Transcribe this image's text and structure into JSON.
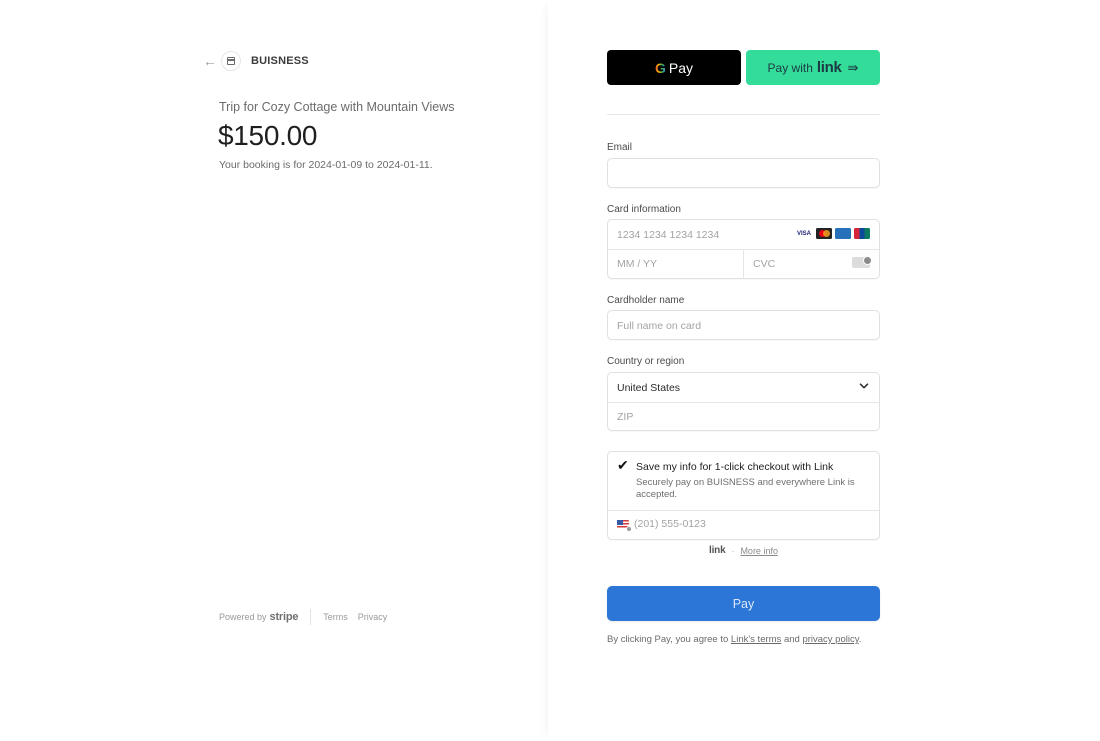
{
  "merchant": {
    "name": "BUISNESS",
    "back_icon": "back-arrow-icon",
    "logo_icon": "store-icon"
  },
  "summary": {
    "product": "Trip for Cozy Cottage with Mountain Views",
    "price": "$150.00",
    "booking_note": "Your booking is for 2024-01-09 to 2024-01-11."
  },
  "footer": {
    "powered_by": "Powered by",
    "stripe": "stripe",
    "terms": "Terms",
    "privacy": "Privacy"
  },
  "express": {
    "gpay_g": "G",
    "gpay_label": "Pay",
    "link_prefix": "Pay with",
    "link_logo": "link",
    "link_arrow": "⇛"
  },
  "form": {
    "email_label": "Email",
    "email_value": "",
    "card_label": "Card information",
    "card_number_placeholder": "1234 1234 1234 1234",
    "card_expiry_placeholder": "MM / YY",
    "card_cvc_placeholder": "CVC",
    "card_brands": [
      "VISA",
      "Mastercard",
      "Amex",
      "UnionPay"
    ],
    "cardholder_label": "Cardholder name",
    "cardholder_placeholder": "Full name on card",
    "country_label": "Country or region",
    "country_value": "United States",
    "zip_placeholder": "ZIP"
  },
  "link_save": {
    "checked": true,
    "title": "Save my info for 1-click checkout with Link",
    "description": "Securely pay on BUISNESS and everywhere Link is accepted.",
    "phone_placeholder": "(201) 555-0123",
    "logo": "link",
    "separator": "·",
    "more_info": "More info"
  },
  "pay": {
    "label": "Pay",
    "color": "#2b76d6"
  },
  "legal": {
    "prefix": "By clicking Pay, you agree to",
    "terms_link": "Link's terms",
    "and": "and",
    "privacy_link": "privacy policy",
    "suffix": "."
  },
  "colors": {
    "link_green": "#33dd99",
    "gpay_black": "#000000",
    "pay_blue": "#2b76d6"
  }
}
